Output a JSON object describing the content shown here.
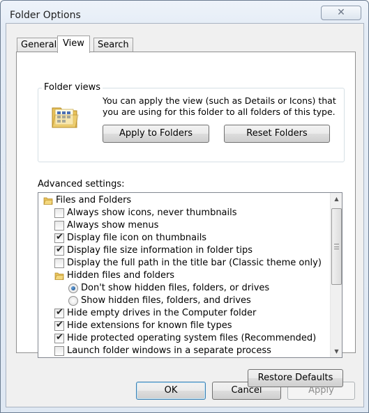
{
  "window": {
    "title": "Folder Options",
    "close_glyph": "✕"
  },
  "tabs": [
    {
      "label": "General",
      "active": false
    },
    {
      "label": "View",
      "active": true
    },
    {
      "label": "Search",
      "active": false
    }
  ],
  "folder_views": {
    "legend": "Folder views",
    "description": "You can apply the view (such as Details or Icons) that you are using for this folder to all folders of this type.",
    "apply_button": "Apply to Folders",
    "reset_button": "Reset Folders",
    "icon": "folder-icon"
  },
  "advanced": {
    "label": "Advanced settings:",
    "items": [
      {
        "type": "folder",
        "label": "Files and Folders",
        "indent": 0
      },
      {
        "type": "checkbox",
        "label": "Always show icons, never thumbnails",
        "checked": false,
        "indent": 1
      },
      {
        "type": "checkbox",
        "label": "Always show menus",
        "checked": false,
        "indent": 1
      },
      {
        "type": "checkbox",
        "label": "Display file icon on thumbnails",
        "checked": true,
        "indent": 1
      },
      {
        "type": "checkbox",
        "label": "Display file size information in folder tips",
        "checked": true,
        "indent": 1
      },
      {
        "type": "checkbox",
        "label": "Display the full path in the title bar (Classic theme only)",
        "checked": false,
        "indent": 1
      },
      {
        "type": "folder",
        "label": "Hidden files and folders",
        "indent": 1
      },
      {
        "type": "radio",
        "label": "Don't show hidden files, folders, or drives",
        "checked": true,
        "indent": 2
      },
      {
        "type": "radio",
        "label": "Show hidden files, folders, and drives",
        "checked": false,
        "indent": 2
      },
      {
        "type": "checkbox",
        "label": "Hide empty drives in the Computer folder",
        "checked": true,
        "indent": 1
      },
      {
        "type": "checkbox",
        "label": "Hide extensions for known file types",
        "checked": true,
        "indent": 1
      },
      {
        "type": "checkbox",
        "label": "Hide protected operating system files (Recommended)",
        "checked": true,
        "indent": 1
      },
      {
        "type": "checkbox",
        "label": "Launch folder windows in a separate process",
        "checked": false,
        "indent": 1
      }
    ],
    "check_glyph": "✔",
    "scroll_up_glyph": "▲",
    "scroll_down_glyph": "▼"
  },
  "buttons": {
    "restore_defaults": "Restore Defaults",
    "ok": "OK",
    "cancel": "Cancel",
    "apply": "Apply"
  }
}
